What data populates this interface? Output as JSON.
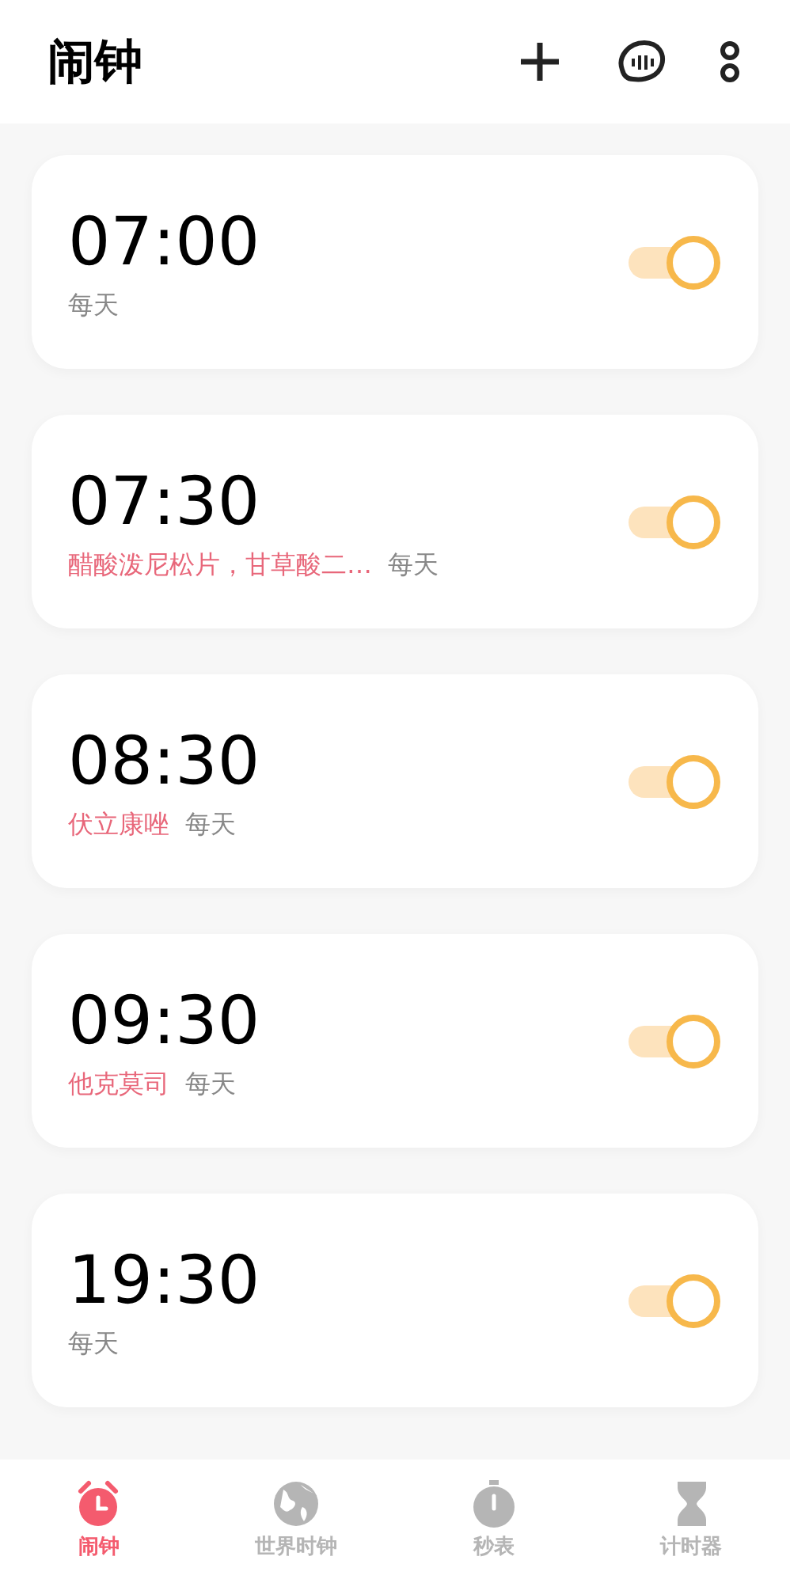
{
  "title": "闹钟",
  "alarms": [
    {
      "time": "07:00",
      "repeat": "每天",
      "on": true
    },
    {
      "time": "07:30",
      "label": "醋酸泼尼松片，甘草酸二…",
      "repeat": "每天",
      "on": true
    },
    {
      "time": "08:30",
      "label": "伏立康唑",
      "repeat": "每天",
      "on": true
    },
    {
      "time": "09:30",
      "label": "他克莫司",
      "repeat": "每天",
      "on": true
    },
    {
      "time": "19:30",
      "repeat": "每天",
      "on": true
    }
  ],
  "tabs": [
    {
      "label": "闹钟",
      "kind": "alarm",
      "selected": true
    },
    {
      "label": "世界时钟",
      "kind": "globe",
      "selected": false
    },
    {
      "label": "秒表",
      "kind": "stopwatch",
      "selected": false
    },
    {
      "label": "计时器",
      "kind": "timer",
      "selected": false
    }
  ]
}
